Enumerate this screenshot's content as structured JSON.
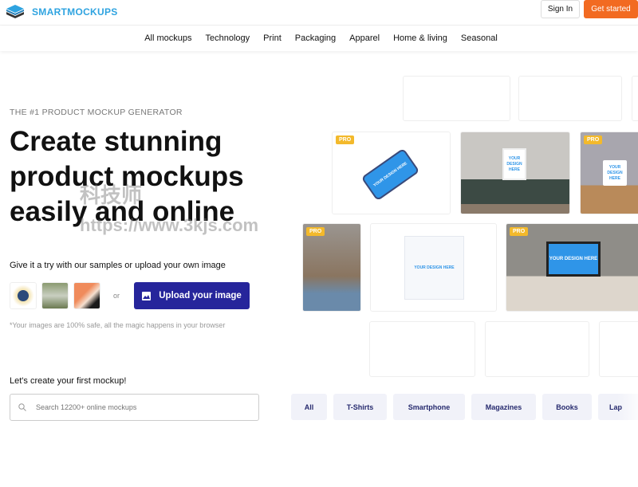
{
  "header": {
    "brand": "SMARTMOCKUPS",
    "sign_in": "Sign In",
    "get_started": "Get started"
  },
  "nav": [
    "All mockups",
    "Technology",
    "Print",
    "Packaging",
    "Apparel",
    "Home & living",
    "Seasonal"
  ],
  "hero": {
    "eyebrow": "THE #1 PRODUCT MOCKUP GENERATOR",
    "title": "Create stunning product mockups easily and online",
    "try_text": "Give it a try with our samples or upload your own image",
    "or": "or",
    "upload_label": "Upload your image",
    "safe_note": "*Your images are 100% safe, all the magic happens in your browser"
  },
  "search": {
    "heading": "Let's create your first mockup!",
    "placeholder": "Search 12200+ online mockups",
    "value": ""
  },
  "chips": [
    "All",
    "T-Shirts",
    "Smartphone",
    "Magazines",
    "Books",
    "Lap"
  ],
  "mockups": {
    "pro_label": "PRO",
    "design_text": "YOUR DESIGN HERE"
  },
  "watermark": {
    "line1": "科技师",
    "line2": "https://www.3kjs.com"
  },
  "colors": {
    "brand": "#2ea3e0",
    "accent": "#f26a21",
    "primary": "#26259b",
    "pro": "#f3b92b"
  }
}
